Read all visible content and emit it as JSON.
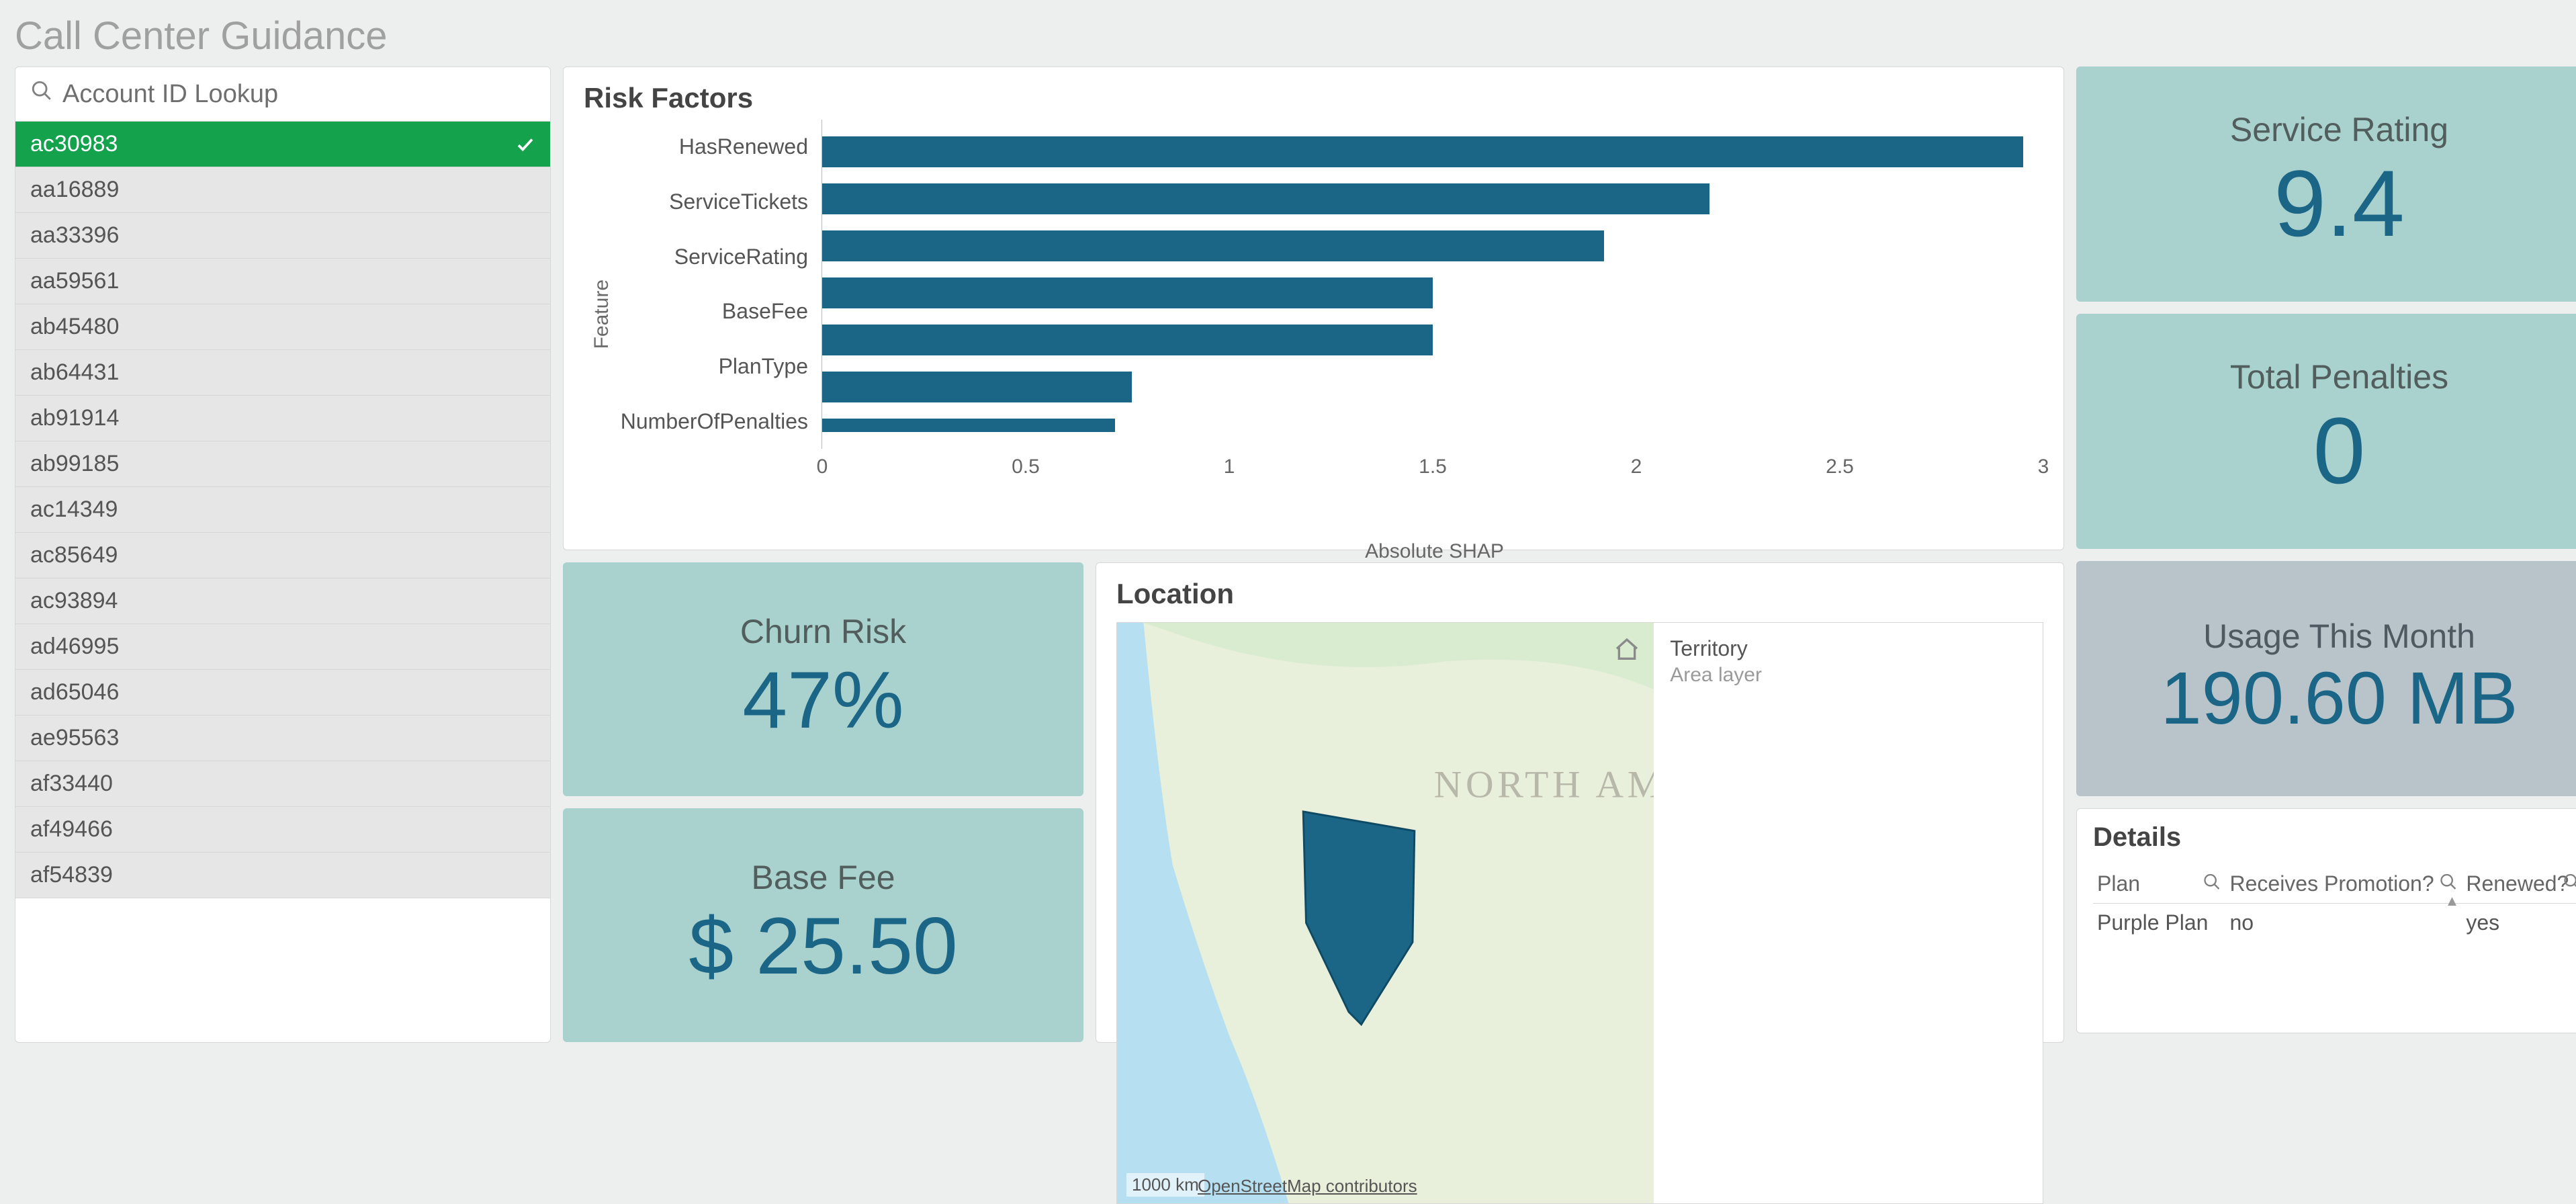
{
  "page": {
    "title": "Call Center Guidance"
  },
  "accounts": {
    "search_label": "Account ID Lookup",
    "items": [
      {
        "id": "ac30983",
        "selected": true
      },
      {
        "id": "aa16889"
      },
      {
        "id": "aa33396"
      },
      {
        "id": "aa59561"
      },
      {
        "id": "ab45480"
      },
      {
        "id": "ab64431"
      },
      {
        "id": "ab91914"
      },
      {
        "id": "ab99185"
      },
      {
        "id": "ac14349"
      },
      {
        "id": "ac85649"
      },
      {
        "id": "ac93894"
      },
      {
        "id": "ad46995"
      },
      {
        "id": "ad65046"
      },
      {
        "id": "ae95563"
      },
      {
        "id": "af33440"
      },
      {
        "id": "af49466"
      },
      {
        "id": "af54839"
      }
    ]
  },
  "risk_factors": {
    "title": "Risk Factors"
  },
  "chart_data": {
    "type": "bar",
    "orientation": "horizontal",
    "ylabel": "Feature",
    "xlabel": "Absolute SHAP",
    "xlim": [
      0,
      3
    ],
    "xticks": [
      0,
      0.5,
      1,
      1.5,
      2,
      2.5,
      3
    ],
    "categories": [
      "HasRenewed",
      "ServiceTickets",
      "ServiceRating",
      "BaseFee",
      "PlanType",
      "NumberOfPenalties"
    ],
    "values": [
      2.95,
      2.18,
      1.92,
      1.5,
      1.5,
      0.76
    ],
    "bar_color": "#1b6586"
  },
  "kpis": {
    "churn": {
      "label": "Churn Risk",
      "value": "47%"
    },
    "basefee": {
      "label": "Base Fee",
      "value": "$ 25.50"
    },
    "service_rating": {
      "label": "Service Rating",
      "value": "9.4"
    },
    "penalties": {
      "label": "Total Penalties",
      "value": "0"
    },
    "usage": {
      "label": "Usage This Month",
      "value": "190.60 MB"
    }
  },
  "location": {
    "title": "Location",
    "legend_title": "Territory",
    "legend_sub": "Area layer",
    "scale": "1000 km",
    "attribution": "OpenStreetMap contributors",
    "continent_label": "NORTH AME"
  },
  "details": {
    "title": "Details",
    "columns": [
      "Plan",
      "Receives Promotion?",
      "Renewed?"
    ],
    "row": {
      "plan": "Purple Plan",
      "promo": "no",
      "renewed": "yes"
    }
  }
}
